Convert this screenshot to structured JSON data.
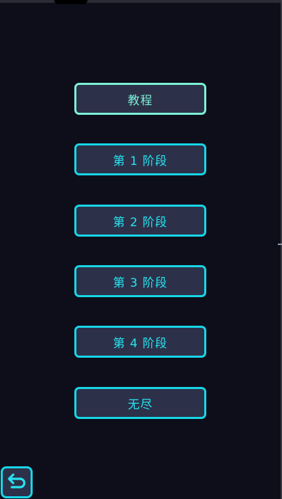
{
  "menu": {
    "tutorial": "教程",
    "stage1": "第 1 阶段",
    "stage2": "第 2 阶段",
    "stage3": "第 3 阶段",
    "stage4": "第 4 阶段",
    "endless": "无尽"
  },
  "back_button": {
    "icon": "return-arrow-icon"
  },
  "colors": {
    "background": "#0d0e1a",
    "button_fill": "#2c3149",
    "accent_cyan": "#17d6e8",
    "accent_mint": "#7df0d5"
  }
}
